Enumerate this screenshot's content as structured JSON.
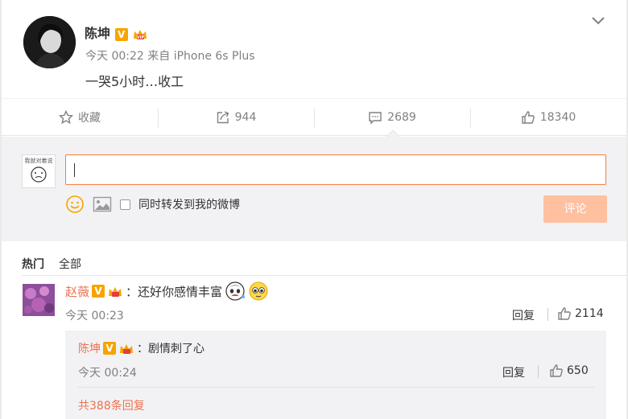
{
  "post": {
    "author": "陈坤",
    "meta": "今天 00:22 来自 iPhone 6s Plus",
    "text": "一哭5小时…收工",
    "verified_badge": "V"
  },
  "actions": {
    "favorite_label": "收藏",
    "repost_count": "944",
    "comment_count": "2689",
    "like_count": "18340"
  },
  "compose": {
    "avatar_text": "我就对着说",
    "repost_checkbox_label": "同时转发到我的微博",
    "submit_label": "评论"
  },
  "tabs": {
    "hot": "热门",
    "all": "全部"
  },
  "comment": {
    "user": "赵薇",
    "text": "：还好你感情丰富",
    "time": "今天 00:23",
    "reply_label": "回复",
    "like_count": "2114"
  },
  "subreply": {
    "user": "陈坤",
    "text": "：剧情刺了心",
    "time": "今天 00:24",
    "reply_label": "回复",
    "like_count": "650",
    "more_label": "共388条回复"
  },
  "colors": {
    "accent": "#eb7350",
    "badge": "#f7a400",
    "submit_disabled": "#ffc09f"
  }
}
